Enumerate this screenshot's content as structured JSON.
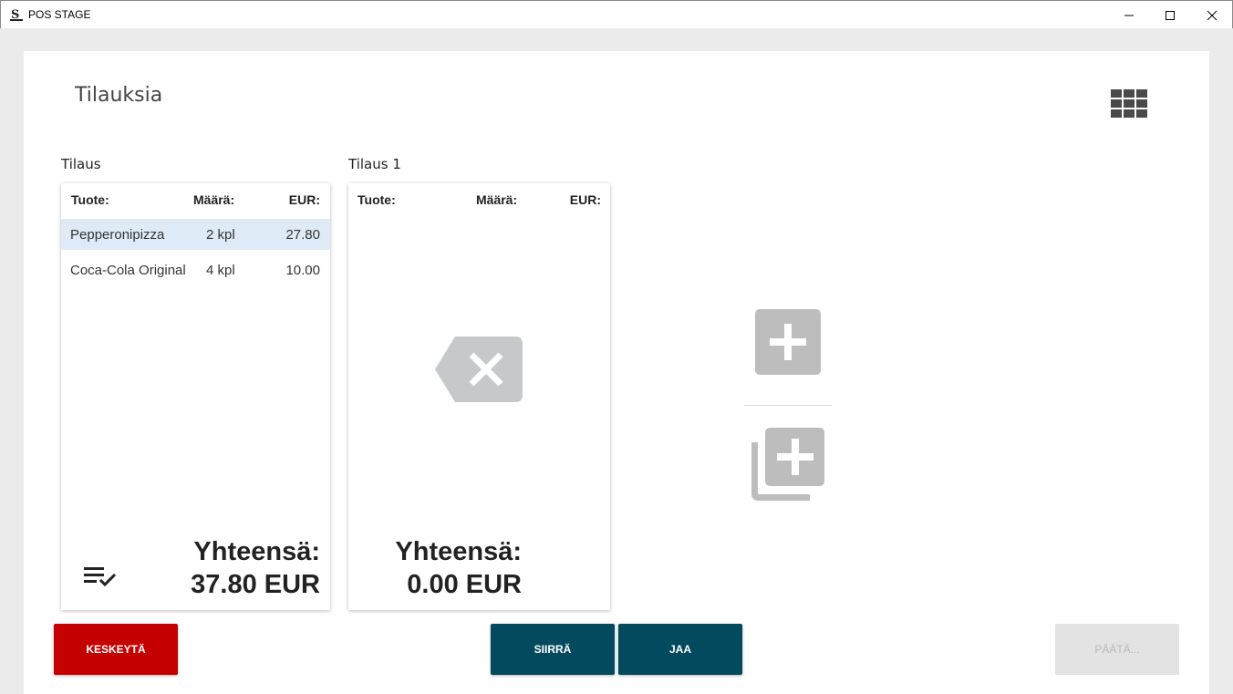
{
  "window": {
    "title": "POS STAGE"
  },
  "page": {
    "title": "Tilauksia"
  },
  "orders": [
    {
      "label": "Tilaus",
      "headers": {
        "product": "Tuote:",
        "qty": "Määrä:",
        "eur": "EUR:"
      },
      "rows": [
        {
          "product": "Pepperonipizza",
          "qty": "2 kpl",
          "eur": "27.80",
          "selected": true
        },
        {
          "product": "Coca-Cola Original",
          "qty": "4 kpl",
          "eur": "10.00",
          "selected": false
        }
      ],
      "total_label": "Yhteensä:",
      "total_value": "37.80 EUR"
    },
    {
      "label": "Tilaus 1",
      "headers": {
        "product": "Tuote:",
        "qty": "Määrä:",
        "eur": "EUR:"
      },
      "rows": [],
      "total_label": "Yhteensä:",
      "total_value": "0.00 EUR"
    }
  ],
  "buttons": {
    "cancel": "KESKEYTÄ",
    "move": "SIIRRÄ",
    "split": "JAA",
    "finish": "PÄÄTÄ..."
  },
  "icons": {
    "app": "pos-logo-icon",
    "grid": "grid-view-icon",
    "list_check": "list-check-icon",
    "clear": "backspace-clear-icon",
    "add": "add-box-icon",
    "add_multiple": "library-add-icon"
  },
  "colors": {
    "cancel": "#c40000",
    "primary": "#034a5e",
    "disabled": "#e3e3e3",
    "selected_row": "#deebf7",
    "icon_grey": "#bdbdbd"
  }
}
